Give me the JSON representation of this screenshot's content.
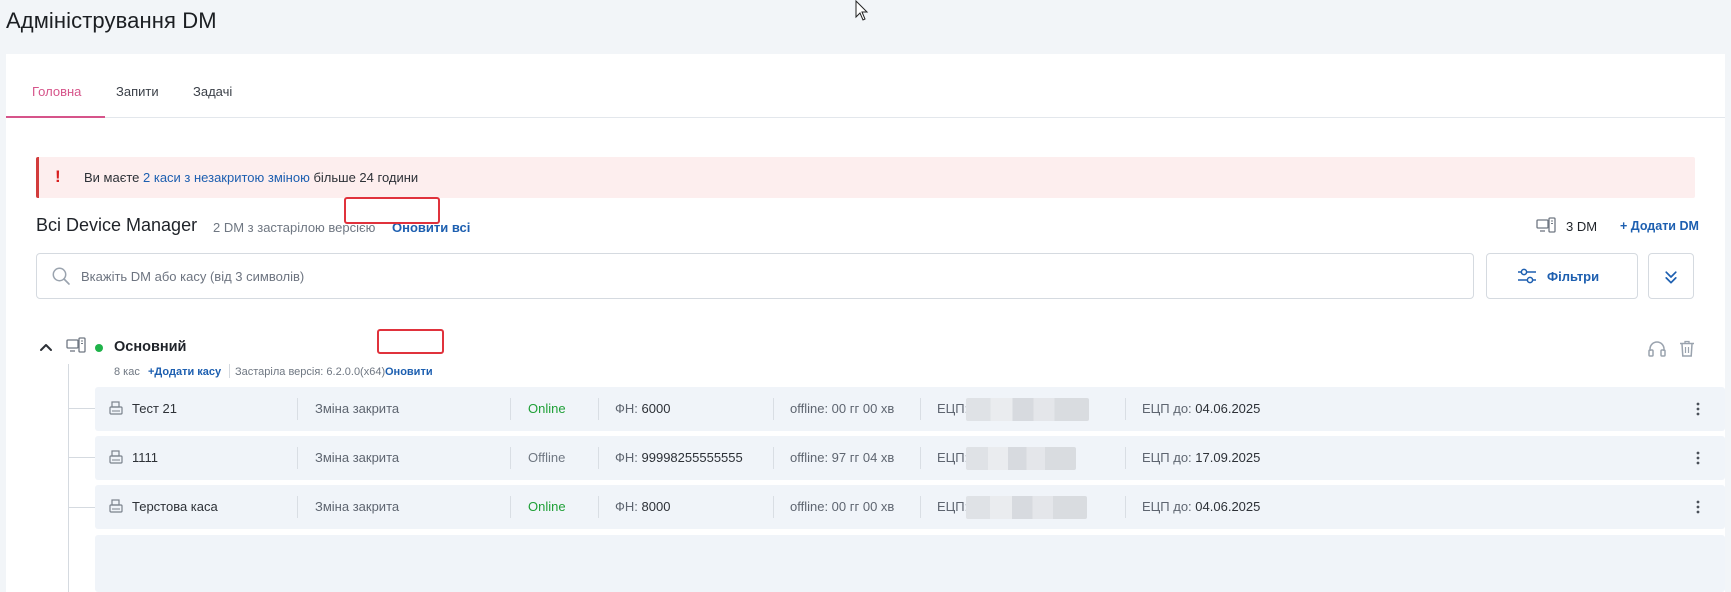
{
  "page": {
    "title": "Адміністрування DM"
  },
  "tabs": [
    {
      "label": "Головна",
      "active": true
    },
    {
      "label": "Запити",
      "active": false
    },
    {
      "label": "Задачі",
      "active": false
    }
  ],
  "alert": {
    "prefix": "Ви маєте ",
    "link": "2 каси з незакритою зміною",
    "suffix": " більше 24 години",
    "icon": "exclamation-icon"
  },
  "section": {
    "title": "Всі Device Manager",
    "subtitle": "2 DM з застарілою версією",
    "update_all": "Оновити всі",
    "dm_count": "3 DM",
    "add_dm": "+ Додати DM"
  },
  "search": {
    "placeholder": "Вкажіть DM або касу (від 3 символів)"
  },
  "filters": {
    "label": "Фільтри"
  },
  "group": {
    "name": "Основний",
    "status": "online",
    "cash_count": "8 кас",
    "add_cash": "+Додати касу",
    "outdated": "Застаріла версія: 6.2.0.0(x64)",
    "update": "Оновити"
  },
  "row_labels": {
    "fn": "ФН:",
    "ecp": "ЕЦП:",
    "ecp_until": "ЕЦП до:"
  },
  "rows": [
    {
      "name": "Тест 21",
      "shift": "Зміна закрита",
      "status": "Online",
      "fn": "6000",
      "offline": "offline: 00 гг 00 хв",
      "ecp_until": "04.06.2025"
    },
    {
      "name": "1111",
      "shift": "Зміна закрита",
      "status": "Offline",
      "fn": "99998255555555",
      "offline": "offline: 97 гг 04 хв",
      "ecp_until": "17.09.2025"
    },
    {
      "name": "Терстова каса",
      "shift": "Зміна закрита",
      "status": "Online",
      "fn": "8000",
      "offline": "offline: 00 гг 00 хв",
      "ecp_until": "04.06.2025"
    }
  ],
  "colors": {
    "accent": "#d6548a",
    "link": "#1d5fb0",
    "online": "#20a038",
    "alert_bg": "#fdeeee",
    "alert_red": "#d81e1e"
  }
}
